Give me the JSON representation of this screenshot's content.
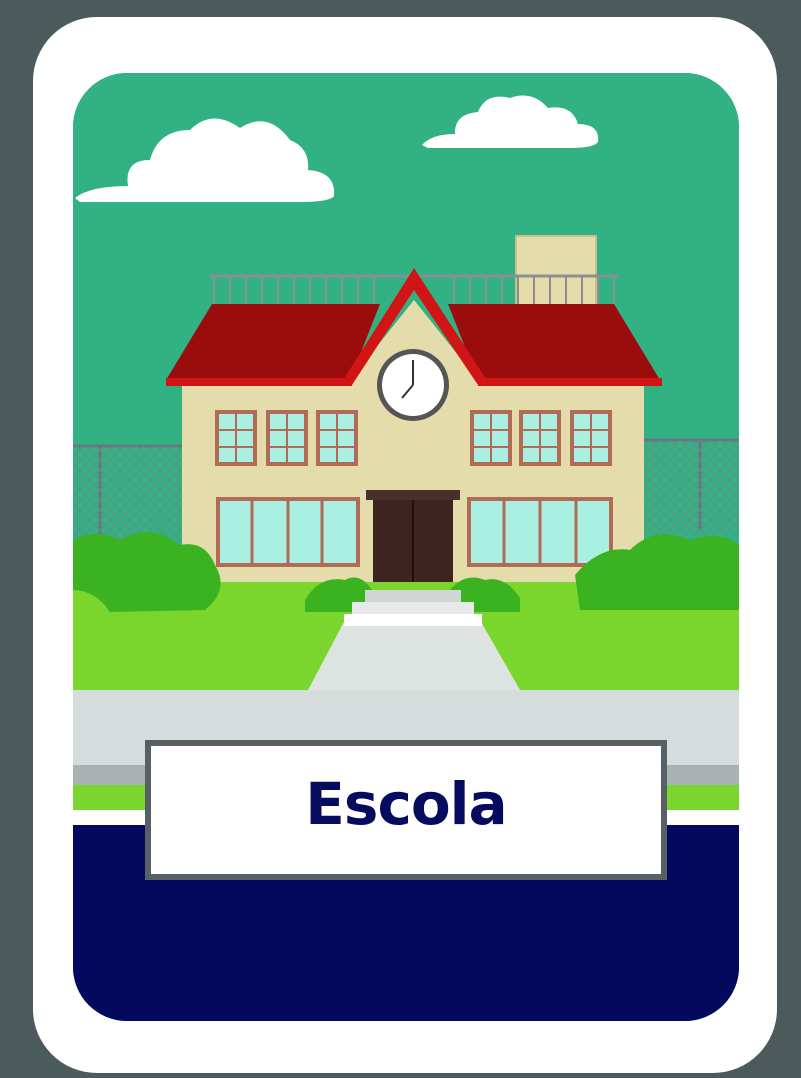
{
  "card": {
    "label": "Escola",
    "label_color": "#050b5e",
    "sky_color": "#32b283",
    "road_color": "#040960",
    "grass_color": "#7ad62c",
    "roof_color": "#9b0c0c",
    "wall_color": "#e4dcaa"
  },
  "illustration": {
    "subject": "school-building",
    "clock_icon": "clock-icon"
  }
}
